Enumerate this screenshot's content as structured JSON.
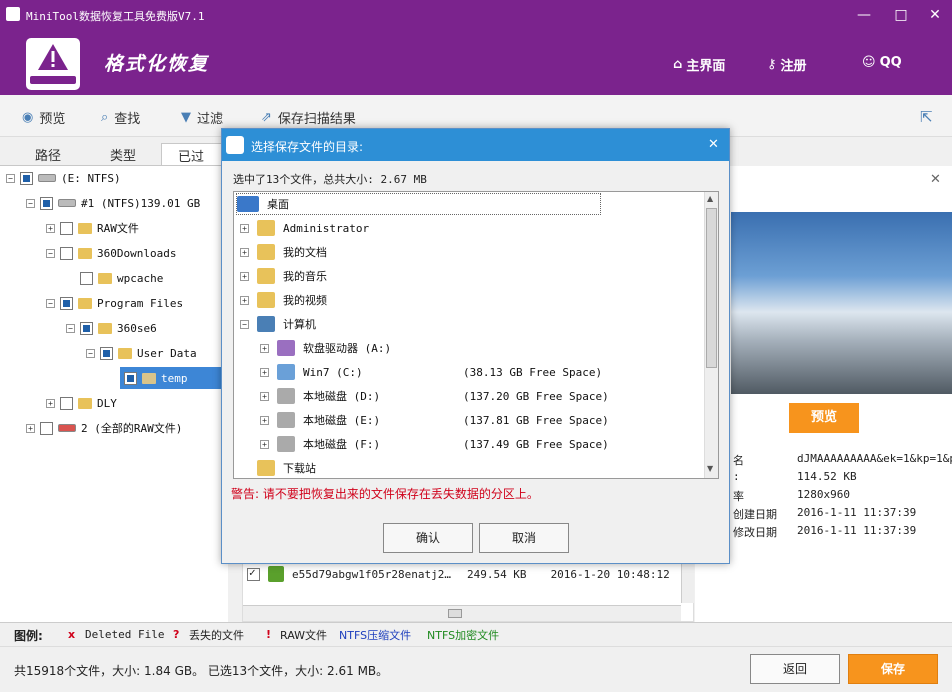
{
  "window": {
    "title": "MiniTool数据恢复工具免费版V7.1",
    "heading": "格式化恢复"
  },
  "topnav": {
    "home": "主界面",
    "register": "注册",
    "qq": "QQ"
  },
  "toolbar": {
    "preview": "预览",
    "find": "查找",
    "filter": "过滤",
    "save_scan": "保存扫描结果"
  },
  "tabs": [
    "路径",
    "类型",
    "已过滤"
  ],
  "tree": [
    {
      "label": "(E: NTFS)"
    },
    {
      "label": "#1 (NTFS)139.01 GB"
    },
    {
      "label": "RAW文件"
    },
    {
      "label": "360Downloads"
    },
    {
      "label": "wpcache"
    },
    {
      "label": "Program Files"
    },
    {
      "label": "360se6"
    },
    {
      "label": "User Data"
    },
    {
      "label": "temp"
    },
    {
      "label": "DLY"
    },
    {
      "label": "2 (全部的RAW文件)"
    }
  ],
  "preview": {
    "button": "预览",
    "info": [
      {
        "k": "名",
        "v": "dJMAAAAAAAAA&ek=1&kp=1&p"
      },
      {
        "k": ":",
        "v": "114.52 KB"
      },
      {
        "k": "率",
        "v": "1280x960"
      },
      {
        "k": "创建日期",
        "v": "2016-1-11 11:37:39"
      },
      {
        "k": "修改日期",
        "v": "2016-1-11 11:37:39"
      }
    ]
  },
  "file_row": {
    "name": "e55d79abgw1f05r28enatj2…",
    "size": "249.54 KB",
    "date": "2016-1-20 10:48:12"
  },
  "legend": {
    "label": "图例:",
    "deleted": "Deleted File",
    "lost": "丢失的文件",
    "raw": "RAW文件",
    "ntfs_comp": "NTFS压缩文件",
    "ntfs_enc": "NTFS加密文件"
  },
  "status": {
    "text": "共15918个文件，大小: 1.84 GB。 已选13个文件，大小: 2.61 MB。",
    "back": "返回",
    "save": "保存"
  },
  "dialog": {
    "title": "选择保存文件的目录:",
    "summary": "选中了13个文件，总共大小: 2.67 MB",
    "items": [
      {
        "label": "桌面",
        "free": ""
      },
      {
        "label": "Administrator",
        "free": ""
      },
      {
        "label": "我的文档",
        "free": ""
      },
      {
        "label": "我的音乐",
        "free": ""
      },
      {
        "label": "我的视频",
        "free": ""
      },
      {
        "label": "计算机",
        "free": ""
      },
      {
        "label": "软盘驱动器 (A:)",
        "free": ""
      },
      {
        "label": "Win7 (C:)",
        "free": "(38.13 GB Free Space)"
      },
      {
        "label": "本地磁盘 (D:)",
        "free": "(137.20 GB Free Space)"
      },
      {
        "label": "本地磁盘 (E:)",
        "free": "(137.81 GB Free Space)"
      },
      {
        "label": "本地磁盘 (F:)",
        "free": "(137.49 GB Free Space)"
      },
      {
        "label": "下载站",
        "free": ""
      }
    ],
    "warning": "警告: 请不要把恢复出来的文件保存在丢失数据的分区上。",
    "ok": "确认",
    "cancel": "取消"
  },
  "colors": {
    "titlebar": "#7b238d",
    "dialog_title": "#2d8fd6",
    "save": "#f7941d",
    "warning": "#d0021b"
  }
}
